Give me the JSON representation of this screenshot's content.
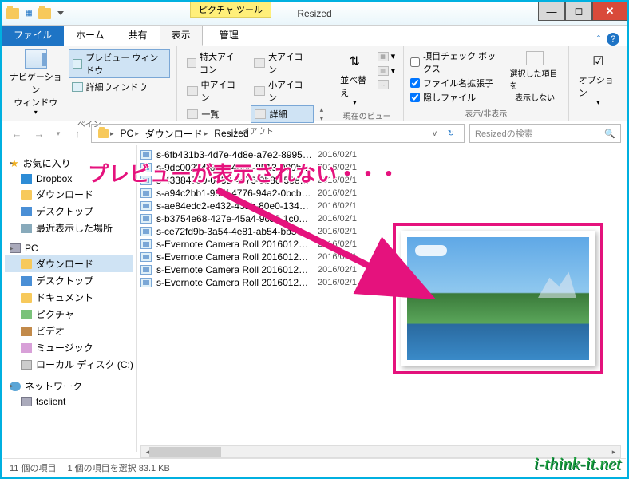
{
  "window": {
    "title": "Resized",
    "tools_context": "ピクチャ ツール",
    "tools_tab": "管理"
  },
  "ribbon_tabs": {
    "file": "ファイル",
    "home": "ホーム",
    "share": "共有",
    "view": "表示"
  },
  "ribbon": {
    "panes": {
      "nav_label": "ナビゲーション\nウィンドウ",
      "preview": "プレビュー ウィンドウ",
      "details": "詳細ウィンドウ",
      "group_label": "ペイン"
    },
    "layout": {
      "xl": "特大アイコン",
      "l": "大アイコン",
      "m": "中アイコン",
      "s": "小アイコン",
      "list": "一覧",
      "details": "詳細",
      "group_label": "レイアウト"
    },
    "current_view": {
      "sort": "並べ替え",
      "cols": "",
      "group_label": "現在のビュー"
    },
    "show_hide": {
      "item_check": "項目チェック ボックス",
      "ext": "ファイル名拡張子",
      "hidden": "隠しファイル",
      "hide_btn_l1": "選択した項目を",
      "hide_btn_l2": "表示しない",
      "group_label": "表示/非表示"
    },
    "options": "オプション"
  },
  "address": {
    "pc": "PC",
    "downloads": "ダウンロード",
    "folder": "Resized"
  },
  "search": {
    "placeholder": "Resizedの検索"
  },
  "sidebar": {
    "favorites": "お気に入り",
    "dropbox": "Dropbox",
    "downloads": "ダウンロード",
    "desktop": "デスクトップ",
    "recent": "最近表示した場所",
    "pc": "PC",
    "pc_downloads": "ダウンロード",
    "pc_desktop": "デスクトップ",
    "documents": "ドキュメント",
    "pictures": "ピクチャ",
    "videos": "ビデオ",
    "music": "ミュージック",
    "localdisk": "ローカル ディスク (C:)",
    "network": "ネットワーク",
    "tsclient": "tsclient"
  },
  "files": [
    {
      "name": "s-6fb431b3-4d7e-4d8e-a7e2-8995d6...",
      "date": "2016/02/1"
    },
    {
      "name": "s-9dc00234-80fe-40bc-8513-000b41...",
      "date": "2016/02/1"
    },
    {
      "name": "s-43384750-0652-4e76-9b86-58e644...",
      "date": "2016/02/1"
    },
    {
      "name": "s-a94c2bb1-985f-4776-94a2-0bcb48...",
      "date": "2016/02/1"
    },
    {
      "name": "s-ae84edc2-e432-431b-80e0-134ed8...",
      "date": "2016/02/1"
    },
    {
      "name": "s-b3754e68-427e-45a4-9c50-1c0837...",
      "date": "2016/02/1"
    },
    {
      "name": "s-ce72fd9b-3a54-4e81-ab54-bb378e...",
      "date": "2016/02/1"
    },
    {
      "name": "s-Evernote Camera Roll 20160129 0...",
      "date": "2016/02/1"
    },
    {
      "name": "s-Evernote Camera Roll 20160129 0...",
      "date": "2016/02/1"
    },
    {
      "name": "s-Evernote Camera Roll 20160129 0...",
      "date": "2016/02/1"
    },
    {
      "name": "s-Evernote Camera Roll 20160129 0...",
      "date": "2016/02/1"
    }
  ],
  "annotation": "プレビューが表示されない・・・",
  "status": {
    "count": "11 個の項目",
    "selection": "1 個の項目を選択 83.1 KB"
  },
  "watermark": "i-think-it.net",
  "colors": {
    "accent": "#1e74c5",
    "highlight": "#e5127d"
  }
}
